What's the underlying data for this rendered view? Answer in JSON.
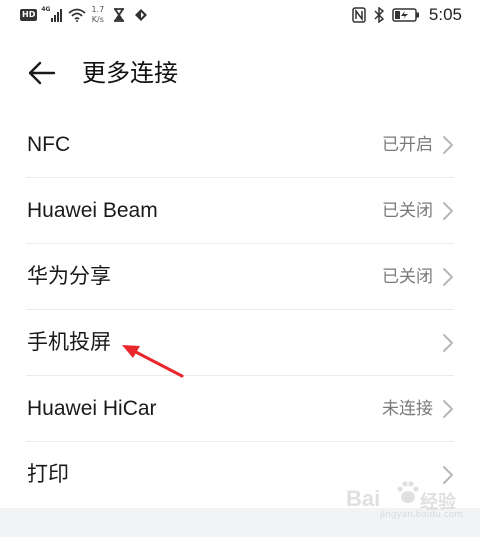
{
  "status_bar": {
    "hd": "HD",
    "network": "4G",
    "speed_value": "1.7",
    "speed_unit": "K/s",
    "time": "5:05",
    "icons": [
      "hd-icon",
      "signal-icon",
      "wifi-icon",
      "hourglass-icon",
      "data-saver-icon",
      "nfc-icon",
      "bluetooth-icon",
      "battery-icon"
    ]
  },
  "header": {
    "title": "更多连接",
    "back_icon": "arrow-left-icon"
  },
  "settings": {
    "items": [
      {
        "label": "NFC",
        "status": "已开启"
      },
      {
        "label": "Huawei Beam",
        "status": "已关闭"
      },
      {
        "label": "华为分享",
        "status": "已关闭"
      },
      {
        "label": "手机投屏",
        "status": ""
      },
      {
        "label": "Huawei HiCar",
        "status": "未连接"
      },
      {
        "label": "打印",
        "status": ""
      }
    ]
  },
  "annotation": {
    "arrow_color": "#e8262b",
    "target": "手机投屏"
  },
  "watermark": {
    "brand": "Bai",
    "brand_cn": "经验",
    "url": "jingyan.baidu.com"
  },
  "colors": {
    "text_primary": "#1a1a1a",
    "text_secondary": "#7a7a7a",
    "divider": "#ebebeb",
    "chevron": "#b8b8b8"
  }
}
